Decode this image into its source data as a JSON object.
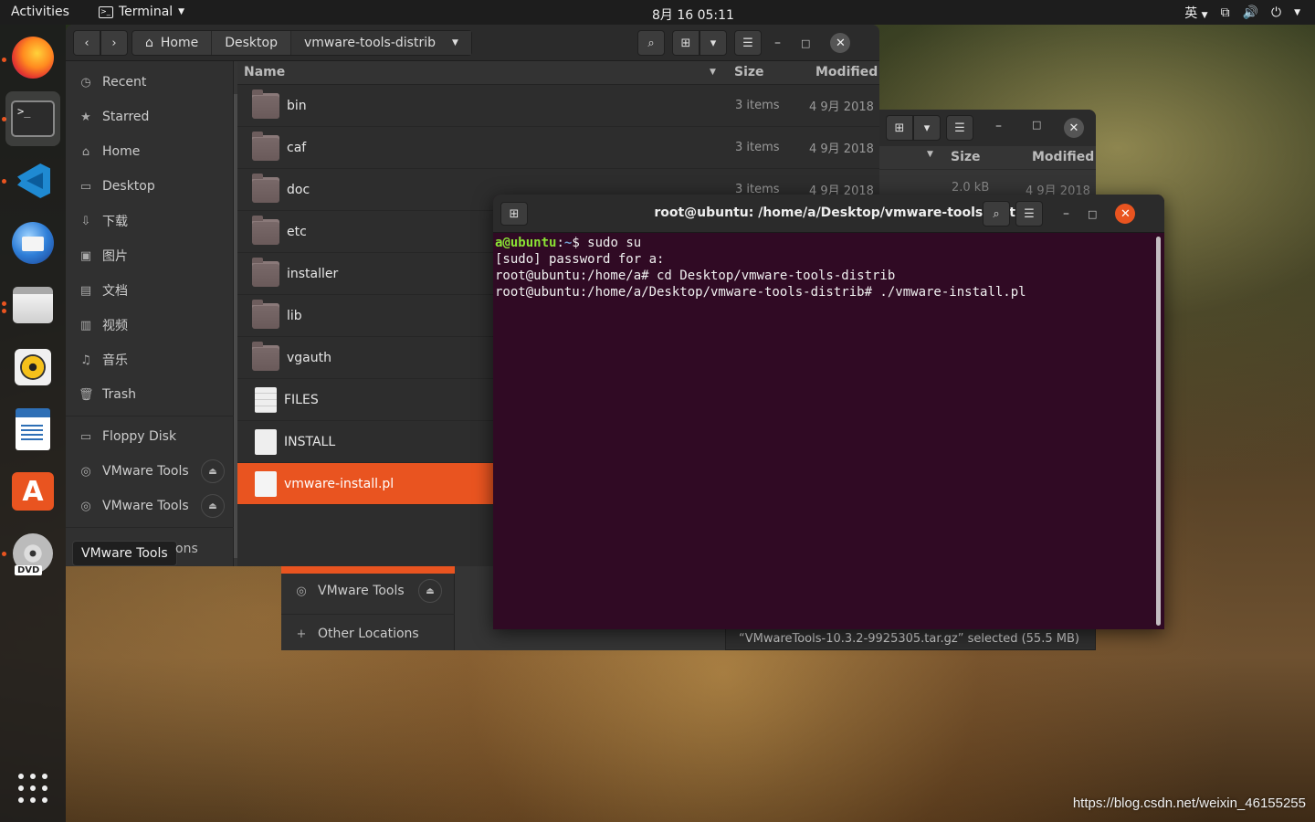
{
  "topbar": {
    "activities": "Activities",
    "app_name": "Terminal",
    "clock": "8月 16  05:11",
    "input_method": "英"
  },
  "dock": {
    "items": [
      "firefox-icon",
      "terminal-icon",
      "vscode-icon",
      "thunderbird-icon",
      "files-icon",
      "rhythmbox-icon",
      "writer-icon",
      "software-center-icon",
      "dvd-icon"
    ],
    "dvd_badge": "DVD"
  },
  "files": {
    "path": [
      "Home",
      "Desktop",
      "vmware-tools-distrib"
    ],
    "columns": {
      "name": "Name",
      "size": "Size",
      "modified": "Modified"
    },
    "sidebar": [
      {
        "label": "Recent"
      },
      {
        "label": "Starred"
      },
      {
        "label": "Home"
      },
      {
        "label": "Desktop"
      },
      {
        "label": "下载"
      },
      {
        "label": "图片"
      },
      {
        "label": "文档"
      },
      {
        "label": "视频"
      },
      {
        "label": "音乐"
      },
      {
        "label": "Trash"
      },
      {
        "label": "Floppy Disk"
      },
      {
        "label": "VMware Tools"
      },
      {
        "label": "VMware Tools"
      }
    ],
    "other_locations_tail": "ons",
    "rows": [
      {
        "name": "bin",
        "size": "3 items",
        "modified": "4 9月 2018"
      },
      {
        "name": "caf",
        "size": "3 items",
        "modified": "4 9月 2018"
      },
      {
        "name": "doc",
        "size": "3 items",
        "modified": "4 9月 2018"
      },
      {
        "name": "etc",
        "size": "",
        "modified": ""
      },
      {
        "name": "installer",
        "size": "",
        "modified": ""
      },
      {
        "name": "lib",
        "size": "",
        "modified": ""
      },
      {
        "name": "vgauth",
        "size": "",
        "modified": ""
      },
      {
        "name": "FILES",
        "size": "",
        "modified": ""
      },
      {
        "name": "INSTALL",
        "size": "",
        "modified": ""
      },
      {
        "name": "vmware-install.pl",
        "size": "",
        "modified": ""
      }
    ]
  },
  "tooltip": "VMware Tools",
  "files_back": {
    "columns": {
      "size": "Size",
      "modified": "Modified"
    },
    "row1": {
      "size": "2.0 kB",
      "modified": "4 9月 2018"
    },
    "sidebar": [
      {
        "label": "VMware Tools"
      },
      {
        "label": "Other Locations"
      }
    ],
    "status": "“VMwareTools-10.3.2-9925305.tar.gz” selected  (55.5 MB)"
  },
  "terminal": {
    "title": "root@ubuntu: /home/a/Desktop/vmware-tools-distrib",
    "lines": {
      "l1_user": "a@ubuntu",
      "l1_sep": ":",
      "l1_path": "~",
      "l1_cmd": "$ sudo su",
      "l2": "[sudo] password for a:",
      "l3": "root@ubuntu:/home/a# cd Desktop/vmware-tools-distrib",
      "l4": "root@ubuntu:/home/a/Desktop/vmware-tools-distrib# ./vmware-install.pl"
    }
  },
  "watermark": "https://blog.csdn.net/weixin_46155255",
  "colors": {
    "accent": "#e95420",
    "terminal_bg": "#300a24",
    "prompt_user": "#8ae234",
    "prompt_path": "#729fcf"
  }
}
